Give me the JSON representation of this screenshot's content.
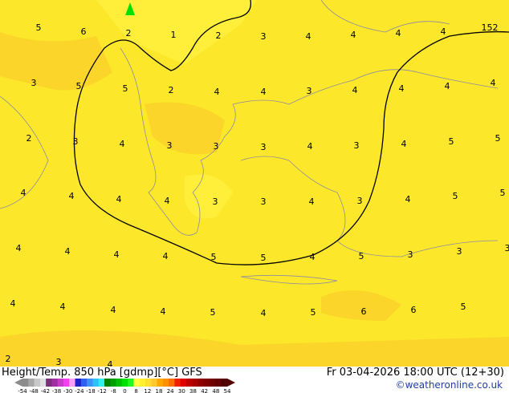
{
  "title": "Height/Temp. 850 hPa [gdmp][°C] GFS",
  "valid_time": "Fr 03-04-2026 18:00 UTC (12+30)",
  "copyright": "©weatheronline.co.uk",
  "colorbar": {
    "ticks": [
      "-54",
      "-48",
      "-42",
      "-38",
      "-30",
      "-24",
      "-18",
      "-12",
      "-8",
      "0",
      "8",
      "12",
      "18",
      "24",
      "30",
      "38",
      "42",
      "48",
      "54"
    ],
    "colors": [
      "#8c8c8c",
      "#a8a8a8",
      "#c8c8c8",
      "#e0e0e0",
      "#7a2f7a",
      "#a030a0",
      "#c83cc8",
      "#f040f0",
      "#f8a0f8",
      "#2020c8",
      "#3060f0",
      "#4090f8",
      "#30c0f8",
      "#30f0f0",
      "#008000",
      "#00a000",
      "#00c000",
      "#00e000",
      "#20f820",
      "#ffff40",
      "#fff030",
      "#ffe030",
      "#ffc830",
      "#ffa800",
      "#ff9000",
      "#ff7000",
      "#f02000",
      "#e00000",
      "#c00000",
      "#a80000",
      "#900000",
      "#800000",
      "#700000",
      "#600000",
      "#500000"
    ]
  },
  "map_colors": {
    "base": "#fde72a",
    "light": "#ffef3a",
    "warm": "#fbd52a",
    "contour": "#000000",
    "coast": "#8c8ca0"
  },
  "contour_labels": [
    [
      "5",
      "6",
      "2",
      "1",
      "2",
      "3",
      "4",
      "4",
      "4",
      "4",
      "152"
    ],
    [
      "3",
      "5",
      "5",
      "2",
      "4",
      "4",
      "3",
      "4",
      "4",
      "4",
      "4"
    ],
    [
      "2",
      "3",
      "4",
      "3",
      "3",
      "3",
      "4",
      "3",
      "4",
      "5",
      "5"
    ],
    [
      "4",
      "4",
      "4",
      "4",
      "3",
      "3",
      "4",
      "3",
      "4",
      "5",
      "5"
    ],
    [
      "4",
      "4",
      "4",
      "4",
      "5",
      "5",
      "4",
      "5",
      "3",
      "3",
      "3"
    ],
    [
      "4",
      "4",
      "4",
      "4",
      "5",
      "4",
      "5",
      "6",
      "6",
      "5"
    ],
    [
      "2",
      "3",
      "4"
    ]
  ]
}
